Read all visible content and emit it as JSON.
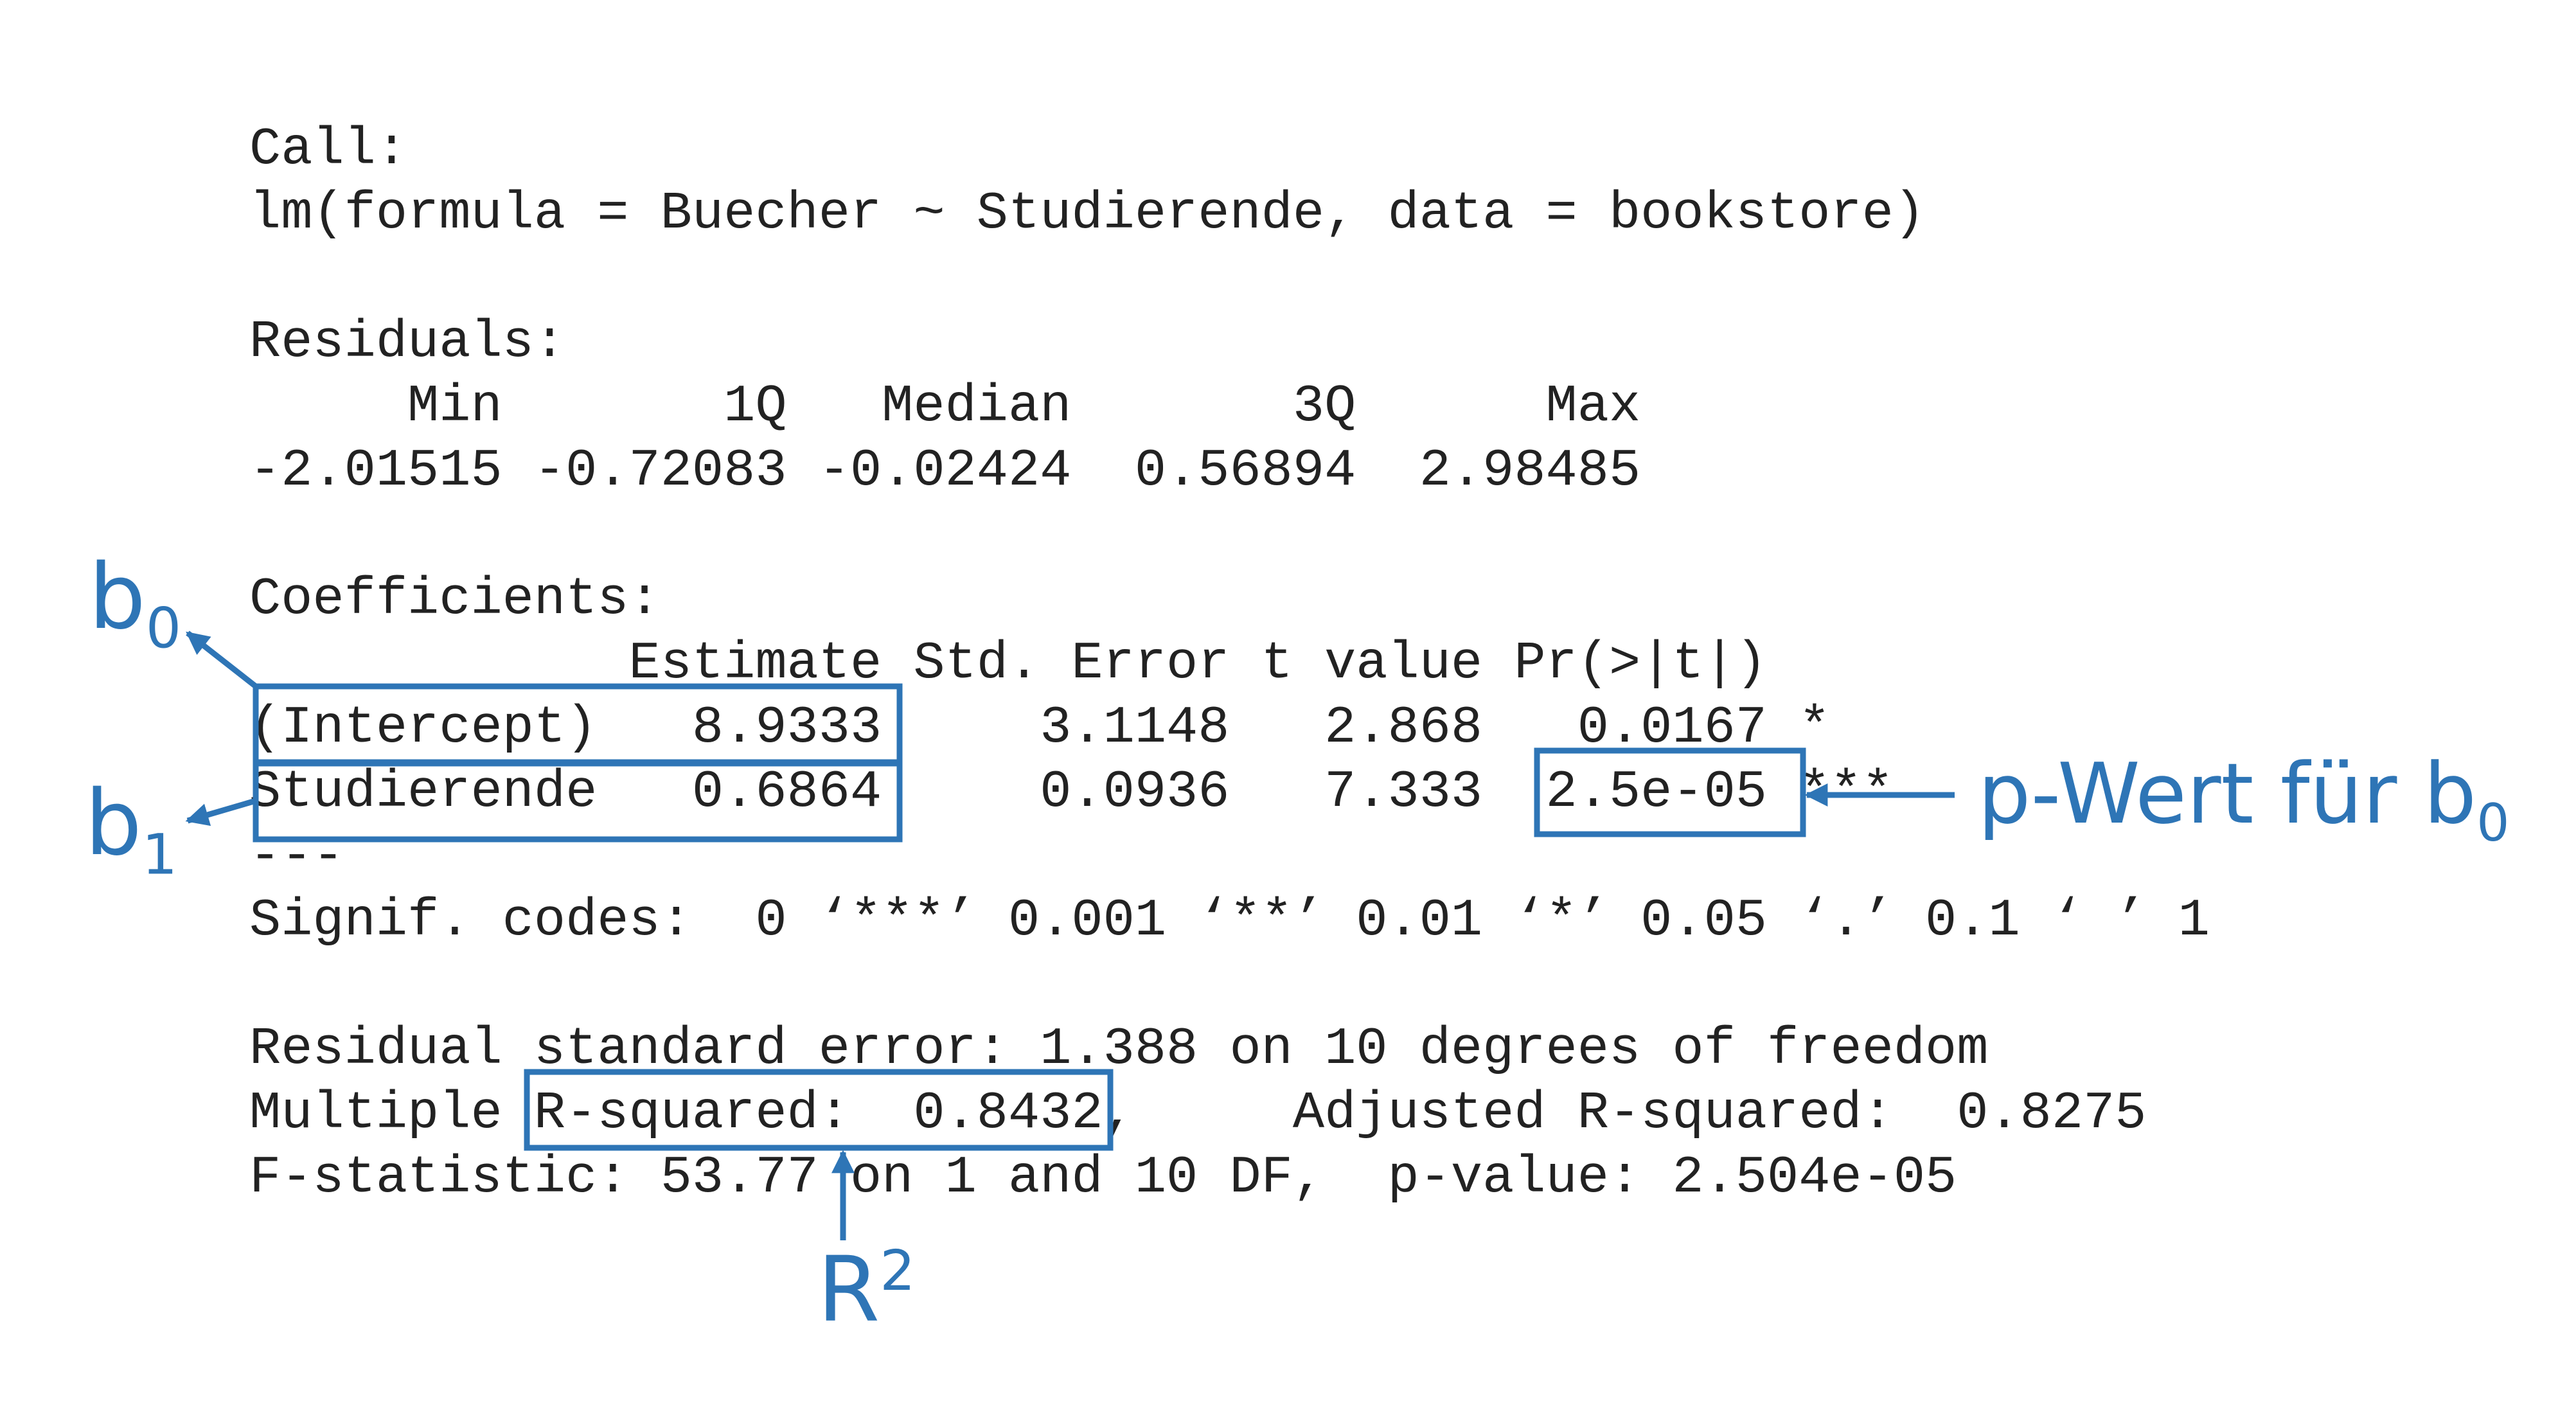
{
  "r_output": {
    "call_header": "Call:",
    "call_formula": "lm(formula = Buecher ~ Studierende, data = bookstore)",
    "residuals_header": "Residuals:",
    "residuals_labels": "     Min       1Q   Median       3Q      Max",
    "residuals_values": "-2.01515 -0.72083 -0.02424  0.56894  2.98485",
    "coefficients_header": "Coefficients:",
    "coef_columns": "            Estimate Std. Error t value Pr(>|t|)",
    "coef_intercept": "(Intercept)   8.9333     3.1148   2.868   0.0167 *",
    "coef_studierende": "Studierende   0.6864     0.0936   7.333  2.5e-05 ***",
    "separator": "---",
    "signif_codes": "Signif. codes:  0 ‘***’ 0.001 ‘**’ 0.01 ‘*’ 0.05 ‘.’ 0.1 ‘ ’ 1",
    "residual_se": "Residual standard error: 1.388 on 10 degrees of freedom",
    "r_squared": "Multiple R-squared:  0.8432,     Adjusted R-squared:  0.8275",
    "f_statistic": "F-statistic: 53.77 on 1 and 10 DF,  p-value: 2.504e-05"
  },
  "annotations": {
    "color": "#2e75b6",
    "b0": {
      "base": "b",
      "sub": "0"
    },
    "b1": {
      "base": "b",
      "sub": "1"
    },
    "pvalue": {
      "text": "p-Wert für b",
      "sub": "0"
    },
    "r2": {
      "base": "R",
      "sup": "2"
    }
  }
}
